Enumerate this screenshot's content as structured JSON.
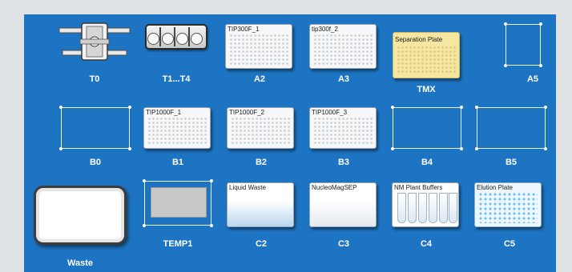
{
  "deck": {
    "row1": {
      "t0": {
        "label": "T0"
      },
      "t1t4": {
        "label": "T1...T4"
      },
      "a2": {
        "label": "A2",
        "plate": "TIP300F_1"
      },
      "a3": {
        "label": "A3",
        "plate": "tip300f_2"
      },
      "tmx": {
        "label": "TMX",
        "plate": "Separation Plate"
      },
      "a5": {
        "label": "A5"
      }
    },
    "row2": {
      "b0": {
        "label": "B0"
      },
      "b1": {
        "label": "B1",
        "plate": "TIP1000F_1"
      },
      "b2": {
        "label": "B2",
        "plate": "TIP1000F_2"
      },
      "b3": {
        "label": "B3",
        "plate": "TIP1000F_3"
      },
      "b4": {
        "label": "B4"
      },
      "b5": {
        "label": "B5"
      }
    },
    "row3": {
      "waste": {
        "label": "Waste"
      },
      "temp1": {
        "label": "TEMP1"
      },
      "c2": {
        "label": "C2",
        "plate": "Liquid Waste"
      },
      "c3": {
        "label": "C3",
        "plate": "NucleoMagSEP"
      },
      "c4": {
        "label": "C4",
        "plate": "NM Plant Buffers"
      },
      "c5": {
        "label": "C5",
        "plate": "Elution Plate"
      }
    }
  },
  "colors": {
    "deck_background": "#1d74c2",
    "page_background": "#dfe3e6",
    "separation_plate": "#f5e7a2",
    "elution_wells": "#6fc3ec"
  },
  "icons": {
    "t0": "tip-rack-holder-icon",
    "t1t4": "tube-holder-icon",
    "waste": "waste-container-icon",
    "temp1": "heating-block-icon"
  }
}
